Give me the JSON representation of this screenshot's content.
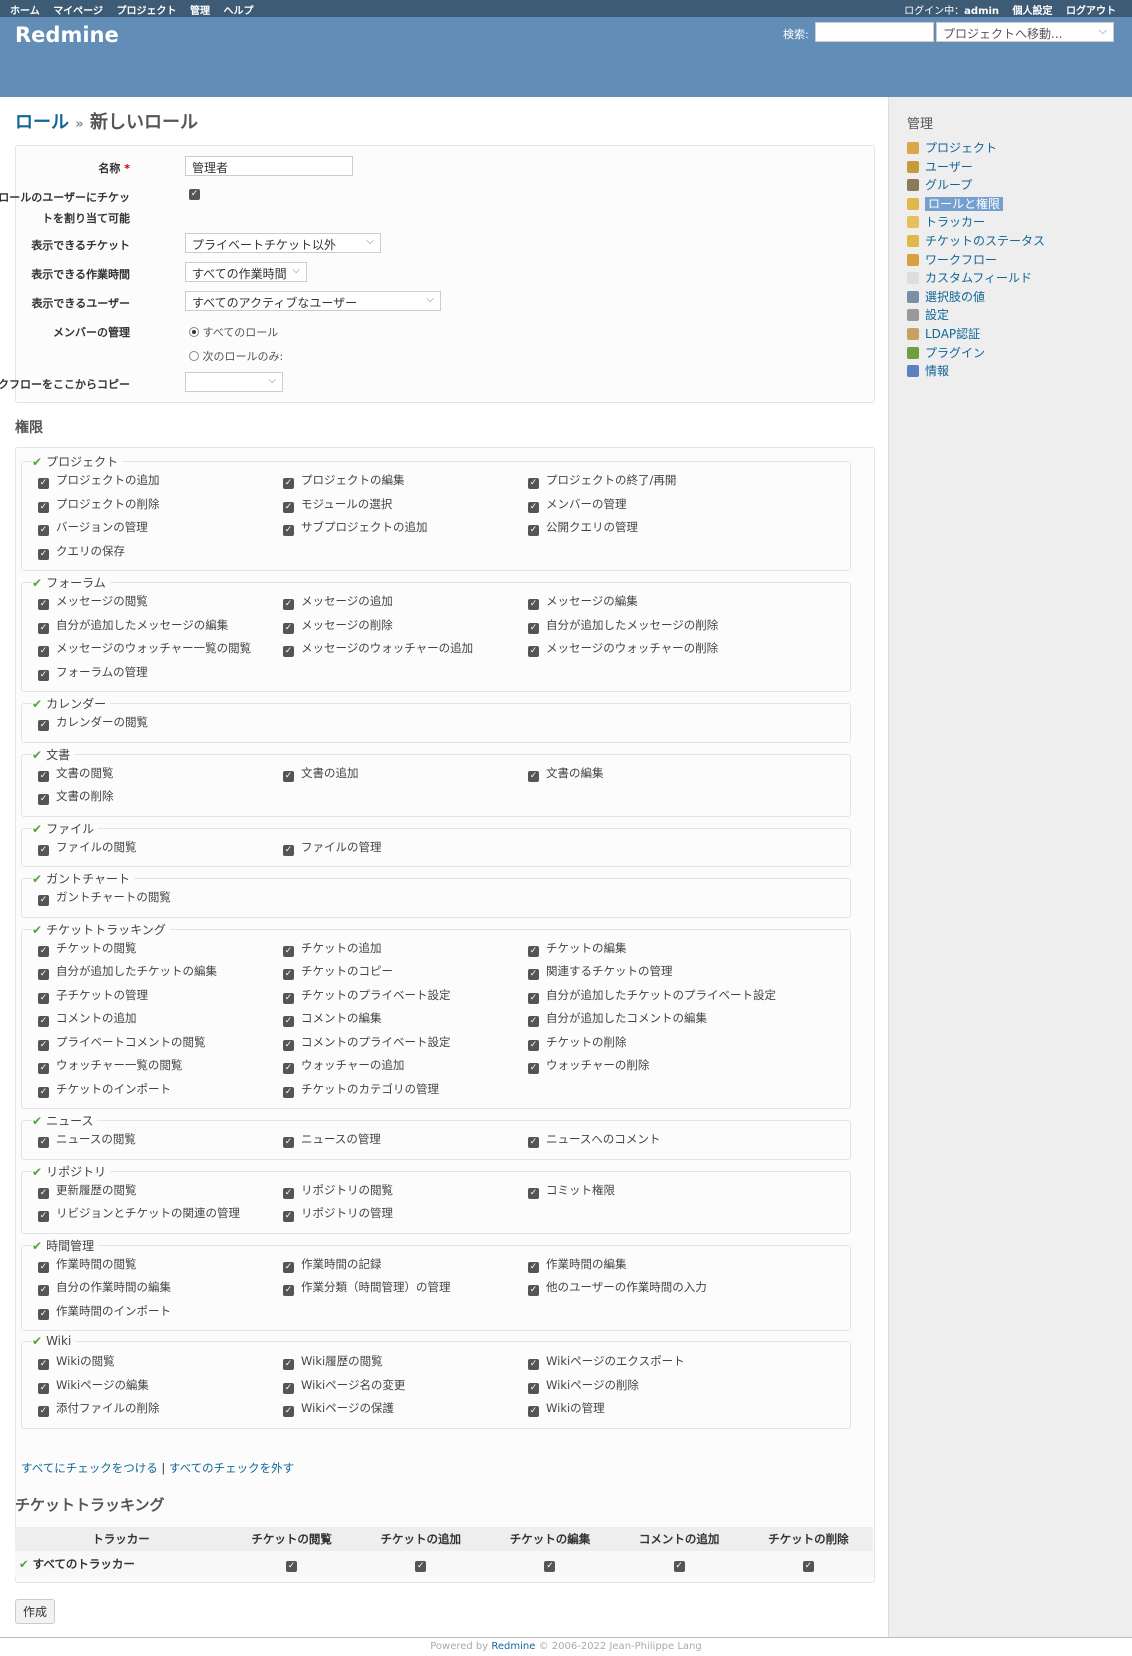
{
  "top_menu": {
    "left": [
      "ホーム",
      "マイページ",
      "プロジェクト",
      "管理",
      "ヘルプ"
    ],
    "login_label": "ログイン中：",
    "login_user": "admin",
    "right": [
      "個人設定",
      "ログアウト"
    ]
  },
  "header": {
    "title": "Redmine",
    "search_label": "検索:",
    "jump_placeholder": "プロジェクトへ移動..."
  },
  "breadcrumb": {
    "parent": "ロール",
    "sep": "»",
    "current": "新しいロール"
  },
  "form": {
    "name_label": "名称",
    "required_mark": "*",
    "name_value": "管理者",
    "assignable_label_1": "このロールのユーザーにチケッ",
    "assignable_label_2": "トを割り当て可能",
    "issues_visibility_label": "表示できるチケット",
    "issues_visibility_value": "プライベートチケット以外",
    "time_visibility_label": "表示できる作業時間",
    "time_visibility_value": "すべての作業時間",
    "users_visibility_label": "表示できるユーザー",
    "users_visibility_value": "すべてのアクティブなユーザー",
    "member_mgmt_label": "メンバーの管理",
    "member_all": "すべてのロール",
    "member_some": "次のロールのみ:",
    "copy_workflow_label": "ワークフローをここからコピー"
  },
  "permissions_title": "権限",
  "permission_groups": [
    {
      "name": "プロジェクト",
      "items": [
        "プロジェクトの追加",
        "プロジェクトの編集",
        "プロジェクトの終了/再開",
        "プロジェクトの削除",
        "モジュールの選択",
        "メンバーの管理",
        "バージョンの管理",
        "サブプロジェクトの追加",
        "公開クエリの管理",
        "クエリの保存"
      ]
    },
    {
      "name": "フォーラム",
      "items": [
        "メッセージの閲覧",
        "メッセージの追加",
        "メッセージの編集",
        "自分が追加したメッセージの編集",
        "メッセージの削除",
        "自分が追加したメッセージの削除",
        "メッセージのウォッチャー一覧の閲覧",
        "メッセージのウォッチャーの追加",
        "メッセージのウォッチャーの削除",
        "フォーラムの管理"
      ]
    },
    {
      "name": "カレンダー",
      "items": [
        "カレンダーの閲覧"
      ]
    },
    {
      "name": "文書",
      "items": [
        "文書の閲覧",
        "文書の追加",
        "文書の編集",
        "文書の削除"
      ]
    },
    {
      "name": "ファイル",
      "items": [
        "ファイルの閲覧",
        "ファイルの管理"
      ]
    },
    {
      "name": "ガントチャート",
      "items": [
        "ガントチャートの閲覧"
      ]
    },
    {
      "name": "チケットトラッキング",
      "items": [
        "チケットの閲覧",
        "チケットの追加",
        "チケットの編集",
        "自分が追加したチケットの編集",
        "チケットのコピー",
        "関連するチケットの管理",
        "子チケットの管理",
        "チケットのプライベート設定",
        "自分が追加したチケットのプライベート設定",
        "コメントの追加",
        "コメントの編集",
        "自分が追加したコメントの編集",
        "プライベートコメントの閲覧",
        "コメントのプライベート設定",
        "チケットの削除",
        "ウォッチャー一覧の閲覧",
        "ウォッチャーの追加",
        "ウォッチャーの削除",
        "チケットのインポート",
        "チケットのカテゴリの管理"
      ]
    },
    {
      "name": "ニュース",
      "items": [
        "ニュースの閲覧",
        "ニュースの管理",
        "ニュースへのコメント"
      ]
    },
    {
      "name": "リポジトリ",
      "items": [
        "更新履歴の閲覧",
        "リポジトリの閲覧",
        "コミット権限",
        "リビジョンとチケットの関連の管理",
        "リポジトリの管理"
      ]
    },
    {
      "name": "時間管理",
      "items": [
        "作業時間の閲覧",
        "作業時間の記録",
        "作業時間の編集",
        "自分の作業時間の編集",
        "作業分類（時間管理）の管理",
        "他のユーザーの作業時間の入力",
        "作業時間のインポート"
      ]
    },
    {
      "name": "Wiki",
      "items": [
        "Wikiの閲覧",
        "Wiki履歴の閲覧",
        "Wikiページのエクスポート",
        "Wikiページの編集",
        "Wikiページ名の変更",
        "Wikiページの削除",
        "添付ファイルの削除",
        "Wikiページの保護",
        "Wikiの管理"
      ]
    }
  ],
  "check_all": "すべてにチェックをつける",
  "link_sep": "|",
  "uncheck_all": "すべてのチェックを外す",
  "tracking_title": "チケットトラッキング",
  "tracking_table": {
    "headers": [
      "トラッカー",
      "チケットの閲覧",
      "チケットの追加",
      "チケットの編集",
      "コメントの追加",
      "チケットの削除"
    ],
    "row_label": "すべてのトラッカー"
  },
  "create_button": "作成",
  "sidebar": {
    "title": "管理",
    "items": [
      {
        "label": "プロジェクト",
        "color": "#d8a84a"
      },
      {
        "label": "ユーザー",
        "color": "#c79a3a"
      },
      {
        "label": "グループ",
        "color": "#8a7a5a"
      },
      {
        "label": "ロールと権限",
        "color": "#e0b84a"
      },
      {
        "label": "トラッカー",
        "color": "#e6c15a"
      },
      {
        "label": "チケットのステータス",
        "color": "#e2b648"
      },
      {
        "label": "ワークフロー",
        "color": "#d9a040"
      },
      {
        "label": "カスタムフィールド",
        "color": "#dddddd"
      },
      {
        "label": "選択肢の値",
        "color": "#7a8fa6"
      },
      {
        "label": "設定",
        "color": "#999999"
      },
      {
        "label": "LDAP認証",
        "color": "#c8a060"
      },
      {
        "label": "プラグイン",
        "color": "#6ea040"
      },
      {
        "label": "情報",
        "color": "#5a82c2"
      }
    ],
    "selected_index": 3
  },
  "footer": {
    "prefix": "Powered by",
    "brand": "Redmine",
    "suffix": "© 2006-2022 Jean-Philippe Lang"
  }
}
